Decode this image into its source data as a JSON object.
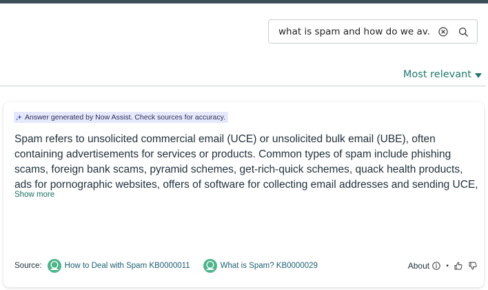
{
  "search": {
    "value": "what is spam and how do we av...",
    "clear_icon": "clear-circle-icon",
    "search_icon": "search-icon"
  },
  "sort": {
    "label": "Most relevant",
    "icon": "caret-down-icon"
  },
  "answer_card": {
    "badge_icon": "sparkle-icon",
    "badge_text": "Answer generated by Now Assist. Check sources for accuracy.",
    "text": "Spam refers to unsolicited commercial email (UCE) or unsolicited bulk email (UBE), often containing advertisements for services or products. Common types of spam include phishing scams, foreign bank scams, pyramid schemes, get-rich-quick schemes, quack health products, ads for pornographic websites, offers of software for collecting email addresses and sending UCE, chain…",
    "show_more_label": "Show more",
    "source_label": "Source:",
    "sources": [
      {
        "label": "How to Deal with Spam KB0000011",
        "icon": "knowledge-article-icon"
      },
      {
        "label": "What is Spam? KB0000029",
        "icon": "knowledge-article-icon"
      }
    ],
    "about_label": "About",
    "about_icon": "info-icon",
    "feedback_icons": [
      "thumbs-up-icon",
      "thumbs-down-icon"
    ]
  },
  "colors": {
    "accent": "#1f7a6a",
    "link": "#1a5f70",
    "badge_bg": "#e6e8fb",
    "top_strip": "#3a4f56",
    "source_icon": "#4cb58c"
  }
}
